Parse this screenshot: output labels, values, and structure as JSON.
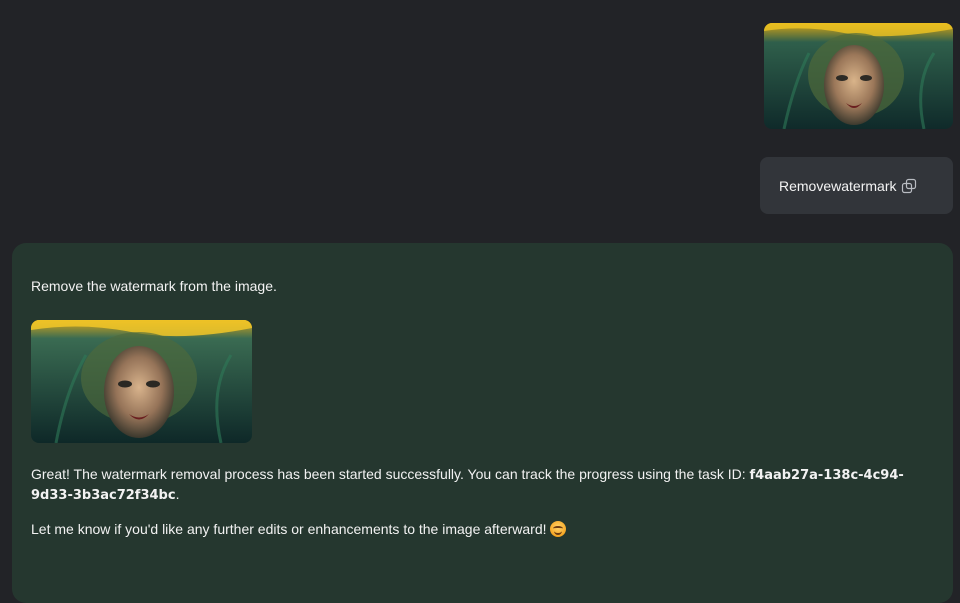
{
  "conversation": {
    "user_image": {
      "alt": "underwater portrait"
    },
    "user_message": {
      "text": "Removewatermark",
      "icon": "link-icon"
    },
    "assistant": {
      "prompt_text": "Remove the watermark from the image.",
      "result_image": {
        "alt": "underwater portrait"
      },
      "reply_line1_prefix": "Great! The watermark removal process has been started successfully. You can track the progress using the task ID: ",
      "task_id": "f4aab27a-138c-4c94-9d33-3b3ac72f34bc",
      "reply_line1_suffix": ".",
      "reply_line2": "Let me know if you'd like any further edits or enhancements to the image afterward!",
      "emoji": "smiling-face-emoji"
    }
  },
  "colors": {
    "background": "#222327",
    "user_bubble": "#32353a",
    "assistant_panel": "#25372f",
    "text": "#f2f2f2"
  }
}
